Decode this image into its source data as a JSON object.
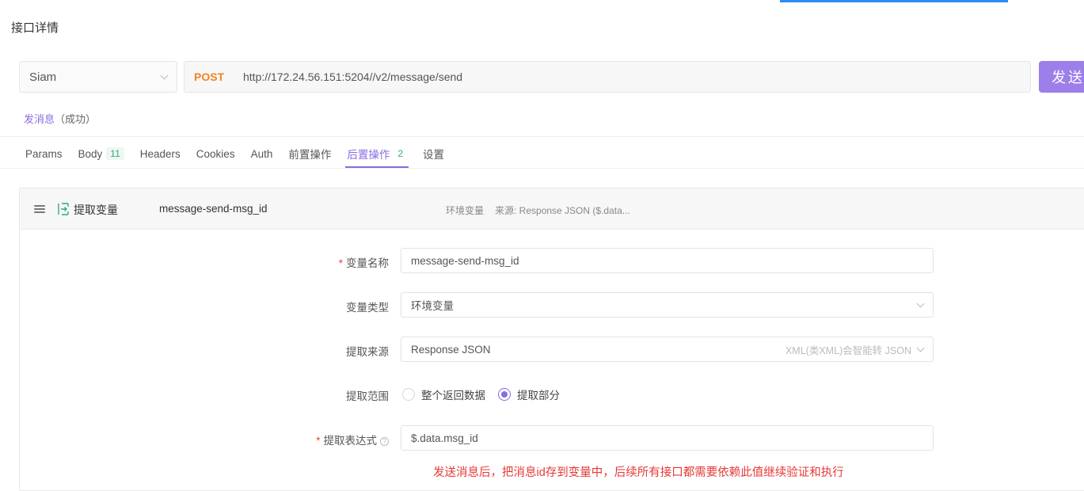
{
  "page_title": "接口详情",
  "request": {
    "environment": "Siam",
    "method": "POST",
    "url": "http://172.24.56.151:5204//v2/message/send",
    "send_label": "发送"
  },
  "status": {
    "name": "发消息",
    "state": "（成功）"
  },
  "tabs": [
    {
      "label": "Params"
    },
    {
      "label": "Body",
      "badge": "11"
    },
    {
      "label": "Headers"
    },
    {
      "label": "Cookies"
    },
    {
      "label": "Auth"
    },
    {
      "label": "前置操作"
    },
    {
      "label": "后置操作",
      "badge": "2",
      "active": true
    },
    {
      "label": "设置"
    }
  ],
  "extract": {
    "header": {
      "title": "提取变量",
      "variable": "message-send-msg_id",
      "scope": "环境变量",
      "source": "来源: Response JSON ($.data..."
    },
    "form": {
      "name_label": "变量名称",
      "name_value": "message-send-msg_id",
      "type_label": "变量类型",
      "type_value": "环境变量",
      "source_label": "提取来源",
      "source_value": "Response JSON",
      "source_hint": "XML(类XML)会智能转 JSON",
      "range_label": "提取范围",
      "range_option_all": "整个返回数据",
      "range_option_part": "提取部分",
      "expr_label": "提取表达式",
      "expr_value": "$.data.msg_id"
    },
    "annotation": "发送消息后，把消息id存到变量中，后续所有接口都需要依赖此值继续验证和执行"
  },
  "colors": {
    "accent": "#8a6be0",
    "method": "#f5831f",
    "badge": "#2eae7a",
    "annotation": "#e53935"
  }
}
